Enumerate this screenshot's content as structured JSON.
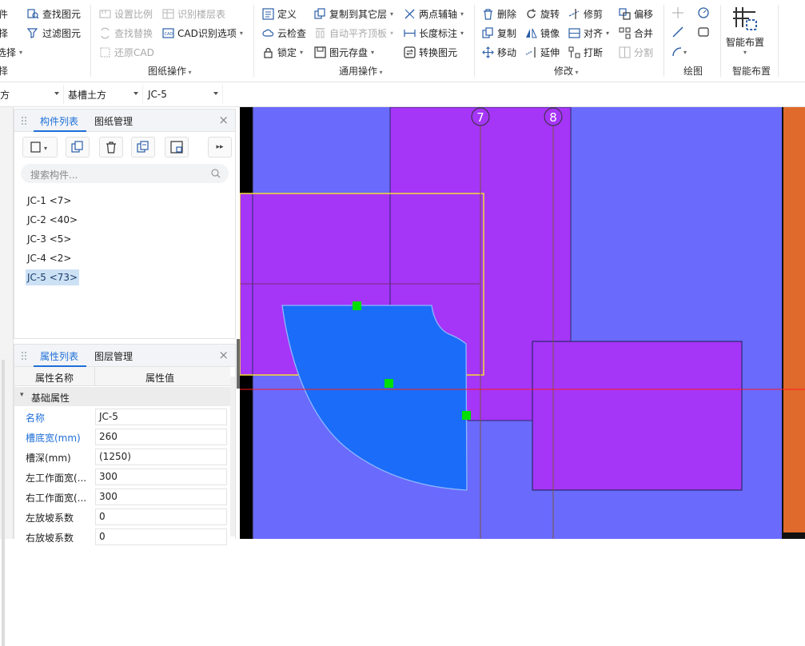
{
  "ribbon": {
    "clipped_left": {
      "row1": "件",
      "row2": "择",
      "row3": "选择",
      "group": "择"
    },
    "find_element": "查找图元",
    "filter_element": "过滤图元",
    "set_scale": "设置比例",
    "find_replace": "查找替换",
    "restore_cad": "还原CAD",
    "recognize_floor": "识别楼层表",
    "cad_options": "CAD识别选项",
    "group_drawing_ops": "图纸操作",
    "define": "定义",
    "cloud_check": "云检查",
    "lock": "锁定",
    "copy_to_floor": "复制到其它层",
    "auto_flat_top": "自动平齐顶板",
    "element_store": "图元存盘",
    "two_point_axis": "两点辅轴",
    "length_dim": "长度标注",
    "convert_element": "转换图元",
    "group_common": "通用操作",
    "delete": "删除",
    "copy": "复制",
    "move": "移动",
    "rotate": "旋转",
    "mirror": "镜像",
    "extend": "延伸",
    "trim": "修剪",
    "align": "对齐",
    "break": "打断",
    "offset": "偏移",
    "merge": "合并",
    "split": "分割",
    "group_modify": "修改",
    "group_draw": "绘图",
    "smart_layout": "智能布置",
    "group_smart": "智能布置"
  },
  "toolbar2": {
    "combo1": "方",
    "combo2": "基槽土方",
    "combo3": "JC-5"
  },
  "component_panel": {
    "tab_active": "构件列表",
    "tab_other": "图纸管理",
    "search_placeholder": "搜索构件...",
    "items": [
      "JC-1 <7>",
      "JC-2 <40>",
      "JC-3 <5>",
      "JC-4 <2>",
      "JC-5 <73>"
    ]
  },
  "property_panel": {
    "tab_active": "属性列表",
    "tab_other": "图层管理",
    "col_name": "属性名称",
    "col_value": "属性值",
    "section": "基础属性",
    "rows": [
      {
        "name": "名称",
        "value": "JC-5"
      },
      {
        "name": "槽底宽(mm)",
        "value": "260"
      },
      {
        "name": "槽深(mm)",
        "value": "(1250)"
      },
      {
        "name": "左工作面宽(...",
        "value": "300"
      },
      {
        "name": "右工作面宽(...",
        "value": "300"
      },
      {
        "name": "左放坡系数",
        "value": "0"
      },
      {
        "name": "右放坡系数",
        "value": "0"
      }
    ]
  },
  "canvas": {
    "axis_labels": [
      "7",
      "8"
    ]
  },
  "colors": {
    "accent": "#1e6fd8",
    "canvas_bg": "#6a6afd",
    "purple_fill": "#a535f7",
    "blue_shape": "#1a6cf9",
    "orange_strip": "#e06a2c",
    "grip": "#00e000"
  }
}
